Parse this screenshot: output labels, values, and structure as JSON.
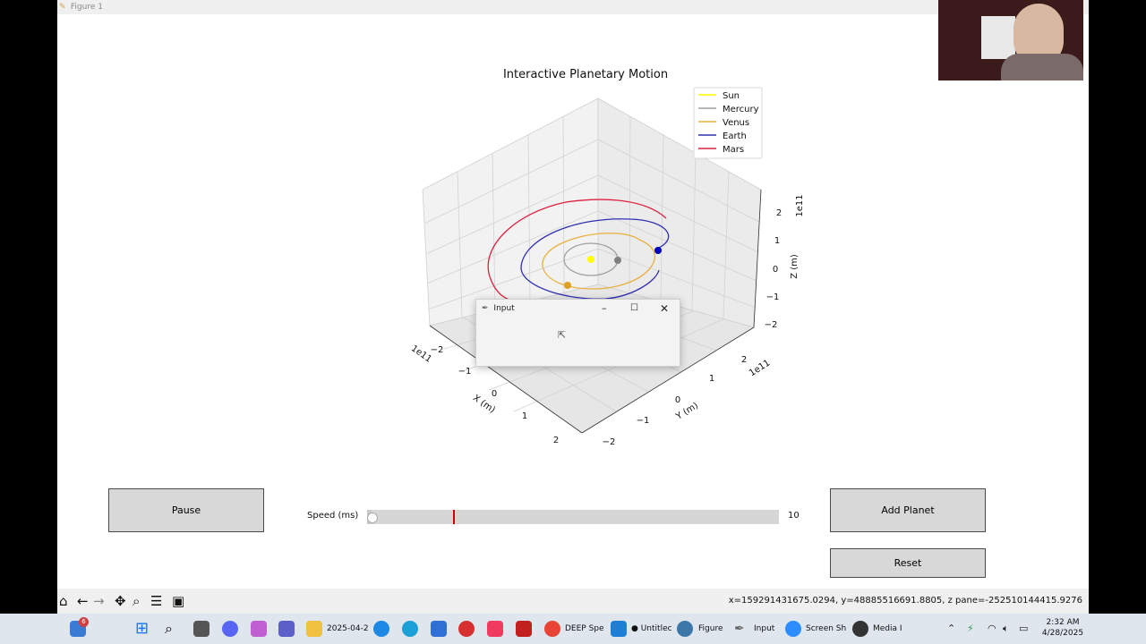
{
  "window": {
    "title": "Figure 1"
  },
  "chart_data": {
    "type": "3d-line",
    "title": "Interactive Planetary Motion",
    "xlabel": "X (m)",
    "ylabel": "Y (m)",
    "zlabel": "Z (m)",
    "x_ticks": [
      "−2",
      "−1",
      "0",
      "1",
      "2"
    ],
    "y_ticks": [
      "−2",
      "−1",
      "0",
      "1",
      "2"
    ],
    "z_ticks": [
      "2",
      "1",
      "0",
      "−1",
      "−2"
    ],
    "x_exponent": "1e11",
    "y_exponent": "1e11",
    "z_exponent": "1e11",
    "legend_position": "top-right",
    "series": [
      {
        "name": "Sun",
        "color": "#ffff00"
      },
      {
        "name": "Mercury",
        "color": "#a0a0a0"
      },
      {
        "name": "Venus",
        "color": "#e8b040"
      },
      {
        "name": "Earth",
        "color": "#3030b0"
      },
      {
        "name": "Mars",
        "color": "#dd2040"
      }
    ]
  },
  "controls": {
    "pause_label": "Pause",
    "speed_label": "Speed (ms)",
    "speed_value": "10",
    "speed_fraction": 0.01,
    "add_planet_label": "Add Planet",
    "reset_label": "Reset"
  },
  "dialog": {
    "title": "Input"
  },
  "toolbar": {
    "coords": "x=159291431675.0294, y=48885516691.8805, z pane=-252510144415.9276"
  },
  "taskbar": {
    "items": [
      {
        "label": "2025-04-2",
        "icon": "folder-icon"
      },
      {
        "label": "DEEP Spe",
        "icon": "chrome-icon"
      },
      {
        "label": "● Untitlec",
        "icon": "vscode-icon"
      },
      {
        "label": "Figure",
        "icon": "python-icon"
      },
      {
        "label": "Input",
        "icon": "feather-icon"
      },
      {
        "label": "Screen Sh",
        "icon": "zoom-icon"
      },
      {
        "label": "Media I",
        "icon": "media-player-icon"
      }
    ],
    "badge_count": "6",
    "time": "2:32 AM",
    "date": "4/28/2025"
  }
}
